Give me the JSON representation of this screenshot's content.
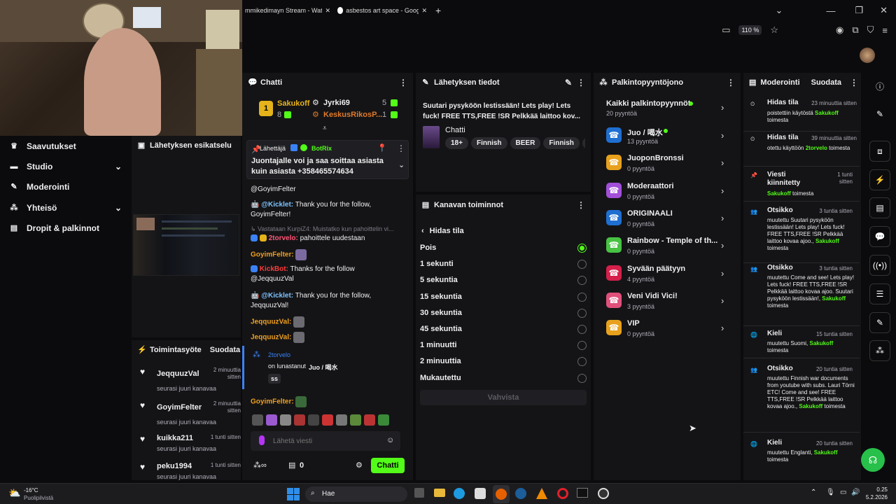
{
  "browser": {
    "tabs": [
      {
        "label": "mmikedimayn Stream - Watch I"
      },
      {
        "label": "asbestos art space - Google-ha"
      }
    ],
    "zoom": "110 %"
  },
  "left_nav": {
    "items": [
      {
        "label": "Saavutukset"
      },
      {
        "label": "Studio"
      },
      {
        "label": "Moderointi"
      },
      {
        "label": "Yhteisö"
      },
      {
        "label": "Dropit & palkinnot"
      }
    ]
  },
  "preview": {
    "title": "Lähetyksen esikatselu"
  },
  "activity": {
    "title": "Toimintasyöte",
    "filter": "Suodata",
    "items": [
      {
        "name": "JeqquuzVal",
        "time": "2 minuuttia sitten",
        "desc": "seurasi juuri kanavaa"
      },
      {
        "name": "GoyimFelter",
        "time": "2 minuuttia sitten",
        "desc": "seurasi juuri kanavaa"
      },
      {
        "name": "kuikka211",
        "time": "1 tunti sitten",
        "desc": "seurasi juuri kanavaa"
      },
      {
        "name": "peku1994",
        "time": "1 tunti sitten",
        "desc": "seurasi juuri kanavaa"
      }
    ]
  },
  "chat": {
    "title": "Chatti",
    "leaders": {
      "first": {
        "name": "Sakukoff",
        "count": "8"
      },
      "second": {
        "name": "Jyrki69",
        "count": "5"
      },
      "third": {
        "name": "KeskusRikosP...",
        "count": "1"
      }
    },
    "pinned": {
      "label": "Lähettäjä",
      "author": "BotRix",
      "text": "Juontajalle voi ja saa soittaa asiasta kuin asiasta +358465574634"
    },
    "messages": [
      {
        "user": "",
        "text": "@GoyimFelter"
      },
      {
        "user": "@Kicklet:",
        "text": "Thank you for the follow, GoyimFelter!"
      },
      {
        "user": "Vastataan KurpiZ4: Muistatko kun pahoittelin vi...",
        "text": ""
      },
      {
        "user": "2torvelo:",
        "text": "pahoittele uudestaan"
      },
      {
        "user": "GoyimFelter:",
        "text": ""
      },
      {
        "user": "KickBot:",
        "text": "Thanks for the follow @JeqquuzVal"
      },
      {
        "user": "@Kicklet:",
        "text": "Thank you for the follow, JeqquuzVal!"
      },
      {
        "user": "JeqquuzVal:",
        "text": ""
      },
      {
        "user": "JeqquuzVal:",
        "text": ""
      },
      {
        "user": "GoyimFelter:",
        "text": ""
      }
    ],
    "redeem": {
      "user": "2torvelo",
      "text": "on lunastanut",
      "reward": "Juo / 喝水",
      "note": "ss"
    },
    "input_placeholder": "Lähetä viesti",
    "points": "0",
    "send": "Chatti"
  },
  "stream_info": {
    "title": "Lähetyksen tiedot",
    "stream_title": "Suutari pysyköön lestissään! Lets play! Lets fuck! FREE TTS,FREE !SR Pelkkää laittoo kov...",
    "category": "Chatti",
    "tags": [
      "18+",
      "Finnish",
      "BEER",
      "Finnish",
      "M"
    ]
  },
  "channel_actions": {
    "title": "Kanavan toiminnot",
    "back_label": "Hidas tila",
    "options": [
      {
        "label": "Pois",
        "selected": true
      },
      {
        "label": "1 sekunti",
        "selected": false
      },
      {
        "label": "5 sekuntia",
        "selected": false
      },
      {
        "label": "15 sekuntia",
        "selected": false
      },
      {
        "label": "30 sekuntia",
        "selected": false
      },
      {
        "label": "45 sekuntia",
        "selected": false
      },
      {
        "label": "1 minuutti",
        "selected": false
      },
      {
        "label": "2 minuuttia",
        "selected": false
      },
      {
        "label": "Mukautettu",
        "selected": false
      }
    ],
    "confirm": "Vahvista"
  },
  "rewards": {
    "title": "Palkintopyyntöjono",
    "all_label": "Kaikki palkintopyynnöt",
    "all_count": "20 pyyntöä",
    "items": [
      {
        "name": "Juo / 喝水",
        "count": "13 pyyntöä",
        "color": "#1f6fd1"
      },
      {
        "name": "JuoponBronssi",
        "count": "0 pyyntöä",
        "color": "#e8a11c"
      },
      {
        "name": "Moderaattori",
        "count": "0 pyyntöä",
        "color": "#a24fd9"
      },
      {
        "name": "ORIGINAALI",
        "count": "0 pyyntöä",
        "color": "#1f6fd1"
      },
      {
        "name": "Rainbow - Temple of th...",
        "count": "0 pyyntöä",
        "color": "#48c242"
      },
      {
        "name": "Syvään päätyyn",
        "count": "4 pyyntöä",
        "color": "#d4204a"
      },
      {
        "name": "Veni Vidi Vici!",
        "count": "3 pyyntöä",
        "color": "#e0507a"
      },
      {
        "name": "VIP",
        "count": "0 pyyntöä",
        "color": "#e8a11c"
      }
    ]
  },
  "moderation": {
    "title": "Moderointi",
    "filter": "Suodata",
    "entries": [
      {
        "title": "Hidas tila",
        "time": "23 minuuttia sitten",
        "body": "poistettiin käytöstä",
        "who": "Sakukoff",
        "tail": "toimesta"
      },
      {
        "title": "Hidas tila",
        "time": "39 minuuttia sitten",
        "body": "otettu käyttöön",
        "who": "2torvelo",
        "tail": "toimesta"
      },
      {
        "title": "Viesti kiinnitetty",
        "time": "1 tunti sitten",
        "body": "",
        "who": "Sakukoff",
        "tail": "toimesta"
      },
      {
        "title": "Otsikko",
        "time": "3 tuntia sitten",
        "body": "muutettu Suutari pysyköön lestissään! Lets play! Lets fuck! FREE TTS,FREE !SR Pelkkää laittoo kovaa ajoo.,",
        "who": "Sakukoff",
        "tail": "toimesta"
      },
      {
        "title": "Otsikko",
        "time": "3 tuntia sitten",
        "body": "muutettu Come and see! Lets play! Lets fuck! FREE TTS,FREE !SR Pelkkää laittoo kovaa ajoo. Suutari pysyköön lestissään!,",
        "who": "Sakukoff",
        "tail": "toimesta"
      },
      {
        "title": "Kieli",
        "time": "15 tuntia sitten",
        "body": "muutettu Suomi,",
        "who": "Sakukoff",
        "tail": "toimesta"
      },
      {
        "title": "Otsikko",
        "time": "20 tuntia sitten",
        "body": "muutettu Finnish war documents from youtube with subs. Lauri Törni ETC! Come and see! FREE TTS,FREE !SR Pelkkää laittoo kovaa ajoo.,",
        "who": "Sakukoff",
        "tail": "toimesta"
      },
      {
        "title": "Kieli",
        "time": "20 tuntia sitten",
        "body": "muutettu Englanti,",
        "who": "Sakukoff",
        "tail": "toimesta"
      }
    ]
  },
  "taskbar": {
    "weather_temp": "-16°C",
    "weather_desc": "Puolipilvistä",
    "search": "Hae",
    "time": "0.25",
    "date": "5.2.2026"
  },
  "colors": {
    "accent": "#53fc18",
    "panel": "#141416",
    "bg": "#0b0b0d"
  }
}
